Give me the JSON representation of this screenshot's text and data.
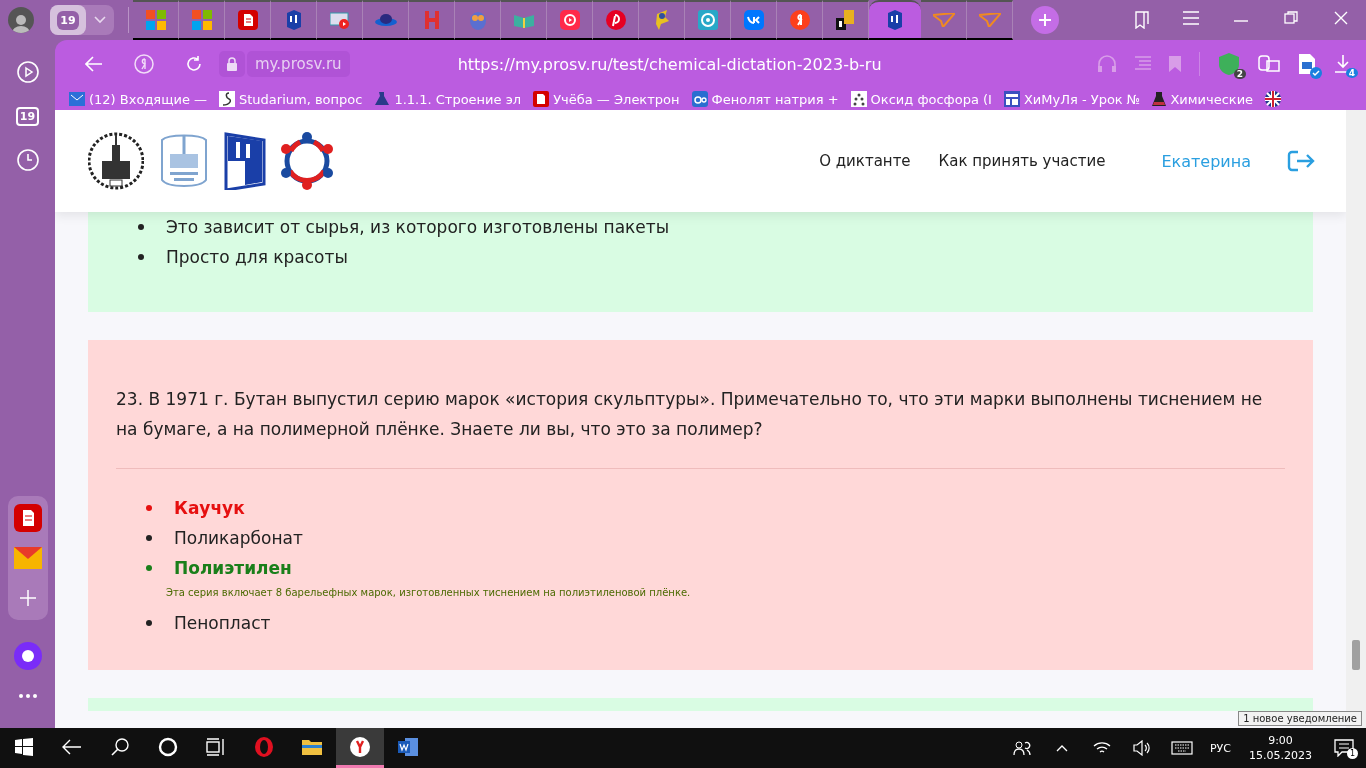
{
  "profile": {
    "kind": "avatar"
  },
  "tab_counter": {
    "count": "19"
  },
  "tabs": [
    {
      "kind": "squares",
      "selected": false
    },
    {
      "kind": "squares",
      "selected": false
    },
    {
      "kind": "doc",
      "selected": false
    },
    {
      "kind": "shield",
      "selected": false
    },
    {
      "kind": "video",
      "selected": false
    },
    {
      "kind": "saucer",
      "selected": false
    },
    {
      "kind": "bars",
      "selected": false
    },
    {
      "kind": "owl",
      "selected": false
    },
    {
      "kind": "book",
      "selected": false
    },
    {
      "kind": "play",
      "selected": false
    },
    {
      "kind": "pin",
      "selected": false
    },
    {
      "kind": "figure",
      "selected": false
    },
    {
      "kind": "speaker",
      "selected": false
    },
    {
      "kind": "vk",
      "selected": false
    },
    {
      "kind": "ya",
      "selected": false
    },
    {
      "kind": "lit",
      "selected": false
    },
    {
      "kind": "shield",
      "selected": true
    },
    {
      "kind": "plane",
      "selected": false
    },
    {
      "kind": "plane",
      "selected": false
    }
  ],
  "sidebar": {
    "top": [
      {
        "kind": "play"
      },
      {
        "kind": "counter",
        "text": "19"
      },
      {
        "kind": "clock"
      }
    ],
    "bottom": [
      {
        "kind": "doc"
      },
      {
        "kind": "mail"
      },
      {
        "kind": "plus"
      },
      {
        "kind": "alice"
      },
      {
        "kind": "more"
      }
    ]
  },
  "address_bar": {
    "domain": "my.prosv.ru",
    "url": "https://my.prosv.ru/test/chemical-dictation-2023-b-ru",
    "shield_count": "2",
    "downloads_count": "4"
  },
  "bookmarks": [
    {
      "kind": "mail",
      "text": "(12) Входящие —"
    },
    {
      "kind": "swan",
      "text": "Studarium, вопрос"
    },
    {
      "kind": "flask",
      "text": "1.1.1. Строение эл"
    },
    {
      "kind": "doc",
      "text": "Учёба — Электрон"
    },
    {
      "kind": "ac",
      "text": "Фенолят натрия +"
    },
    {
      "kind": "dots",
      "text": "Оксид фосфора (I"
    },
    {
      "kind": "layout",
      "text": "ХиМуЛя - Урок №"
    },
    {
      "kind": "beaker",
      "text": "Химические"
    },
    {
      "kind": "flag"
    }
  ],
  "header": {
    "nav": [
      "О диктанте",
      "Как принять участие"
    ],
    "user": "Екатерина"
  },
  "previous_question": {
    "answered_correctly": true,
    "options": [
      {
        "text": "Это зависит от сырья, из которого изготовлены пакеты",
        "wrong": false,
        "correct": false
      },
      {
        "text": "Просто для красоты",
        "wrong": false,
        "correct": false
      }
    ]
  },
  "question": {
    "answered_correctly": false,
    "text": "23. В 1971 г. Бутан выпустил серию марок «история скульптуры». Примечательно то, что эти марки выполнены тиснением не на бумаге, а на полимерной плёнке. Знаете ли вы, что это за полимер?",
    "options": [
      {
        "text": "Каучук",
        "wrong": true,
        "correct": false
      },
      {
        "text": "Поликарбонат",
        "wrong": false,
        "correct": false
      },
      {
        "text": "Полиэтилен",
        "wrong": false,
        "correct": true,
        "explanation": "Эта серия включает 8 барельефных марок, изготовленных тиснением на полиэтиленовой плёнке."
      },
      {
        "text": "Пенопласт",
        "wrong": false,
        "correct": false
      }
    ]
  },
  "next_question": {
    "answered_correctly": true
  },
  "taskbar": {
    "apps": [
      {
        "kind": "opera",
        "selected": false
      },
      {
        "kind": "folder",
        "selected": false
      },
      {
        "kind": "yandex",
        "selected": true
      },
      {
        "kind": "word",
        "selected": false
      }
    ],
    "language": "РУС",
    "time": "9:00",
    "date": "15.05.2023",
    "notifications": "1",
    "tooltip": "1 новое уведомление"
  }
}
